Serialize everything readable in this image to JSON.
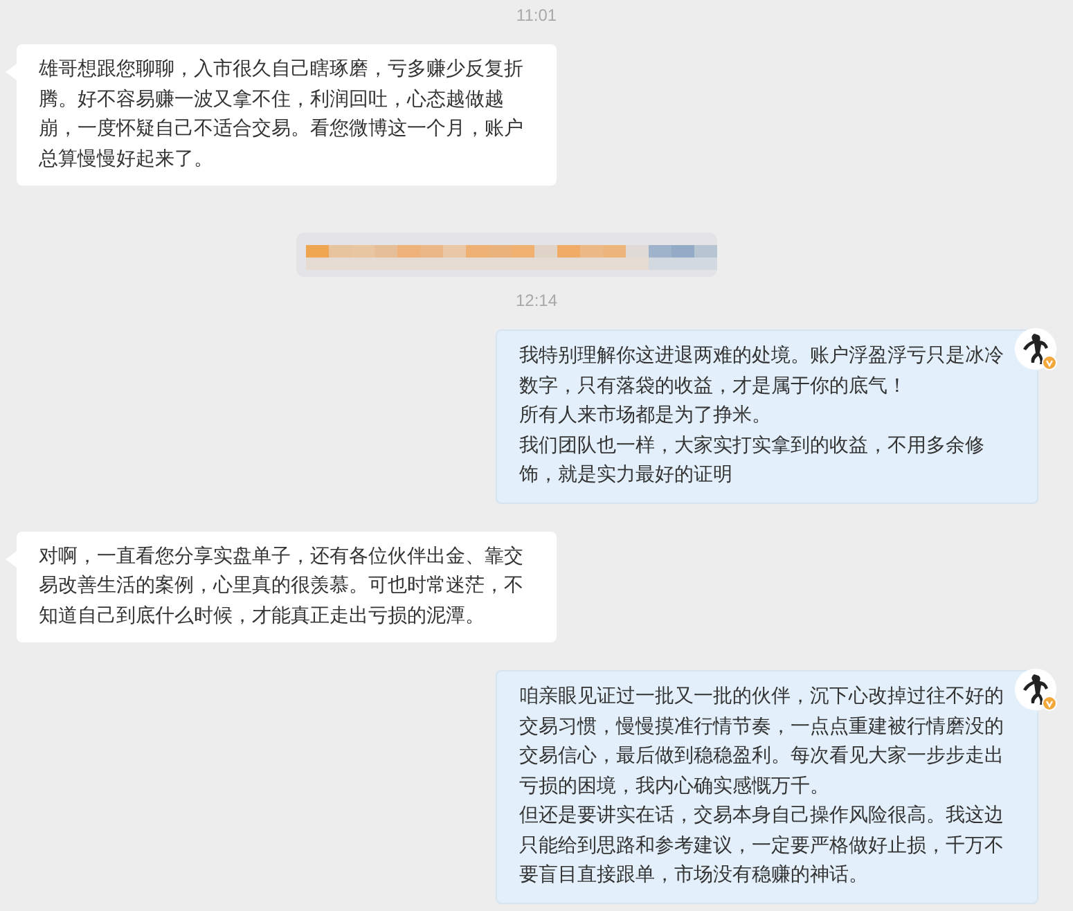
{
  "messages": [
    {
      "kind": "time",
      "text": "11:01"
    },
    {
      "kind": "received",
      "paragraphs": [
        "雄哥想跟您聊聊，入市很久自己瞎琢磨，亏多赚少反复折腾。好不容易赚一波又拿不住，利润回吐，心态越做越崩，一度怀疑自己不适合交易。看您微博这一个月，账户总算慢慢好起来了。"
      ]
    },
    {
      "kind": "redacted"
    },
    {
      "kind": "time",
      "text": "12:14"
    },
    {
      "kind": "sent",
      "paragraphs": [
        "我特别理解你这进退两难的处境。账户浮盈浮亏只是冰冷数字，只有落袋的收益，才是属于你的底气！",
        "所有人来市场都是为了挣米。",
        "我们团队也一样，大家实打实拿到的收益，不用多余修饰，就是实力最好的证明"
      ]
    },
    {
      "kind": "received",
      "paragraphs": [
        "对啊，一直看您分享实盘单子，还有各位伙伴出金、靠交易改善生活的案例，心里真的很羡慕。可也时常迷茫，不知道自己到底什么时候，才能真正走出亏损的泥潭。"
      ]
    },
    {
      "kind": "sent",
      "paragraphs": [
        "咱亲眼见证过一批又一批的伙伴，沉下心改掉过往不好的交易习惯，慢慢摸准行情节奏，一点点重建被行情磨没的交易信心，最后做到稳稳盈利。每次看见大家一步步走出亏损的困境，我内心确实感慨万千。",
        "但还是要讲实在话，交易本身自己操作风险很高。我这边只能给到思路和参考建议，一定要严格做好止损，千万不要盲目直接跟单，市场没有稳赚的神话。"
      ]
    }
  ]
}
